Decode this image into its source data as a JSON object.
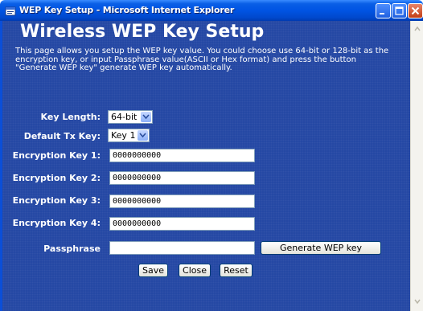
{
  "window": {
    "title": "WEP Key Setup - Microsoft Internet Explorer"
  },
  "page": {
    "heading": "Wireless WEP Key Setup",
    "description": "This page allows you setup the WEP key value. You could choose use 64-bit or 128-bit as the encryption key, or input Passphrase value(ASCII or Hex format) and press the button \"Generate WEP key\" generate WEP key automatically."
  },
  "form": {
    "key_length": {
      "label": "Key Length:",
      "value": "64-bit"
    },
    "default_tx_key": {
      "label": "Default Tx Key:",
      "value": "Key 1"
    },
    "encryption_keys": [
      {
        "label": "Encryption Key 1:",
        "value": "0000000000"
      },
      {
        "label": "Encryption Key 2:",
        "value": "0000000000"
      },
      {
        "label": "Encryption Key 3:",
        "value": "0000000000"
      },
      {
        "label": "Encryption Key 4:",
        "value": "0000000000"
      }
    ],
    "passphrase": {
      "label": "Passphrase",
      "value": ""
    },
    "generate_button": "Generate WEP key",
    "save_button": "Save",
    "close_button": "Close",
    "reset_button": "Reset"
  }
}
